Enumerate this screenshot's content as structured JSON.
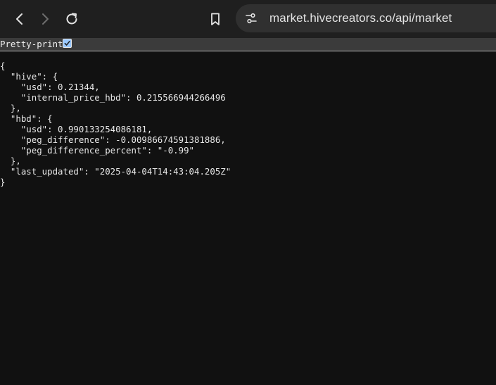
{
  "browser": {
    "url": "market.hivecreators.co/api/market"
  },
  "viewer": {
    "pretty_print_label": "Pretty-print",
    "pretty_print_checked": true
  },
  "json_lines": [
    "{",
    "  \"hive\": {",
    "    \"usd\": 0.21344,",
    "    \"internal_price_hbd\": 0.215566944266496",
    "  },",
    "  \"hbd\": {",
    "    \"usd\": 0.990133254086181,",
    "    \"peg_difference\": -0.00986674591381886,",
    "    \"peg_difference_percent\": \"-0.99\"",
    "  },",
    "  \"last_updated\": \"2025-04-04T14:43:04.205Z\"",
    "}"
  ],
  "icons": {
    "back": "arrow-left-icon",
    "forward": "arrow-right-icon",
    "reload": "reload-icon",
    "bookmark": "bookmark-icon",
    "site_info": "tune-icon",
    "checkbox": "checkmark-icon"
  },
  "colors": {
    "toolbar": "#1f1f1f",
    "omnibox": "#303030",
    "page_background": "#111111",
    "checkbox_fill": "#99c8ff"
  }
}
